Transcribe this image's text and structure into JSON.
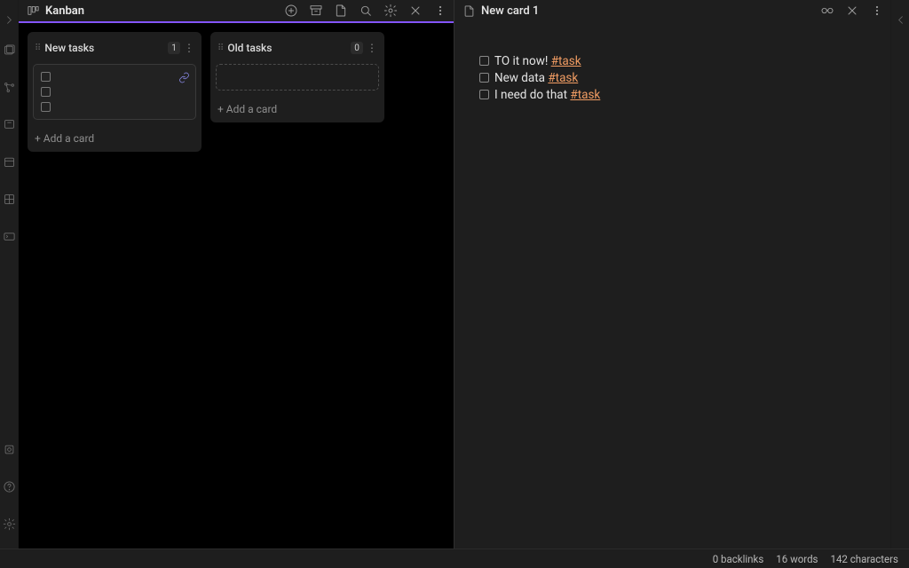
{
  "left_pane": {
    "title": "Kanban",
    "lanes": [
      {
        "name": "New tasks",
        "count": "1",
        "has_card": true,
        "checks": 3
      },
      {
        "name": "Old tasks",
        "count": "0",
        "has_card": false
      }
    ],
    "add_card_label": "+ Add a card"
  },
  "right_pane": {
    "title": "New card 1",
    "lines": [
      {
        "text": "TO it now! ",
        "tag": "#task"
      },
      {
        "text": "New data ",
        "tag": "#task"
      },
      {
        "text": "I need do that ",
        "tag": "#task"
      }
    ]
  },
  "status": {
    "backlinks": "0 backlinks",
    "words": "16 words",
    "chars": "142 characters"
  }
}
